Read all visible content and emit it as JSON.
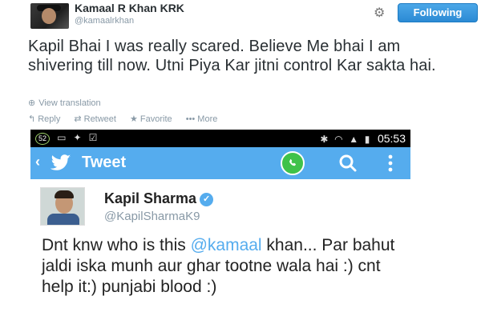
{
  "top_tweet": {
    "author_name": "Kamaal R Khan KRK",
    "author_handle": "@kamaalrkhan",
    "follow_label": "Following",
    "text": "Kapil Bhai I was really scared. Believe Me bhai I am shivering till now. Utni Piya Kar jitni control Kar sakta hai.",
    "view_translation": "View translation",
    "actions": {
      "reply": "Reply",
      "retweet": "Retweet",
      "favorite": "Favorite",
      "more": "More"
    }
  },
  "phone_status": {
    "badge": "52",
    "time": "05:53"
  },
  "app_bar": {
    "title": "Tweet"
  },
  "embedded_tweet": {
    "author_name": "Kapil Sharma",
    "author_handle": "@KapilSharmaK9",
    "text_before": "Dnt knw who is this ",
    "mention": "@kamaal",
    "text_after": " khan... Par bahut jaldi iska munh aur ghar tootne wala hai :) cnt help it:) punjabi blood :)"
  },
  "colors": {
    "twitter_blue": "#55acee",
    "follow_button": "#2b8ad4",
    "whatsapp_green": "#3fc24a",
    "muted_text": "#8899a6"
  },
  "icons": [
    "gear-icon",
    "globe-icon",
    "reply-icon",
    "retweet-icon",
    "star-icon",
    "ellipsis-icon",
    "bluetooth-icon",
    "wifi-icon",
    "signal-icon",
    "battery-icon",
    "back-arrow-icon",
    "twitter-bird-icon",
    "whatsapp-icon",
    "search-icon",
    "overflow-menu-icon",
    "verified-icon"
  ]
}
